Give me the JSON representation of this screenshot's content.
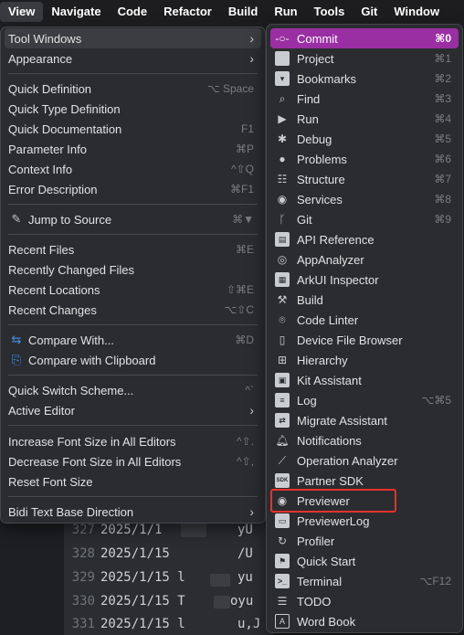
{
  "menubar": {
    "items": [
      "View",
      "Navigate",
      "Code",
      "Refactor",
      "Build",
      "Run",
      "Tools",
      "Git",
      "Window"
    ]
  },
  "editor": {
    "lines": [
      {
        "num": "327",
        "code": "2025/1/1"
      },
      {
        "num": "328",
        "code": "2025/1/15"
      },
      {
        "num": "329",
        "code": "2025/1/15 l"
      },
      {
        "num": "330",
        "code": "2025/1/15 T"
      },
      {
        "num": "331",
        "code": "2025/1/15 l"
      }
    ],
    "right_fragments": [
      "yU",
      "/U",
      "yu",
      "oyu",
      "u,J"
    ]
  },
  "view_menu": {
    "items": [
      {
        "label": "Tool Windows",
        "submenu": true,
        "highlighted": true
      },
      {
        "label": "Appearance",
        "submenu": true
      },
      {
        "label": "Quick Definition",
        "shortcut": "⌥ Space"
      },
      {
        "label": "Quick Type Definition",
        "shortcut": ""
      },
      {
        "label": "Quick Documentation",
        "shortcut": "F1"
      },
      {
        "label": "Parameter Info",
        "shortcut": "⌘P"
      },
      {
        "label": "Context Info",
        "shortcut": "^⇧Q"
      },
      {
        "label": "Error Description",
        "shortcut": "⌘F1"
      },
      {
        "label": "Jump to Source",
        "shortcut": "⌘▼",
        "icon": "pencil-icon"
      },
      {
        "label": "Recent Files",
        "shortcut": "⌘E"
      },
      {
        "label": "Recently Changed Files",
        "shortcut": ""
      },
      {
        "label": "Recent Locations",
        "shortcut": "⇧⌘E"
      },
      {
        "label": "Recent Changes",
        "shortcut": "⌥⇧C"
      },
      {
        "label": "Compare With...",
        "shortcut": "⌘D",
        "icon": "compare-icon"
      },
      {
        "label": "Compare with Clipboard",
        "shortcut": "",
        "icon": "clipboard-compare-icon"
      },
      {
        "label": "Quick Switch Scheme...",
        "shortcut": "^`"
      },
      {
        "label": "Active Editor",
        "submenu": true
      },
      {
        "label": "Increase Font Size in All Editors",
        "shortcut": "^⇧."
      },
      {
        "label": "Decrease Font Size in All Editors",
        "shortcut": "^⇧,"
      },
      {
        "label": "Reset Font Size",
        "shortcut": ""
      },
      {
        "label": "Bidi Text Base Direction",
        "submenu": true
      }
    ]
  },
  "tool_windows_menu": {
    "items": [
      {
        "label": "Commit",
        "shortcut": "⌘0",
        "icon": "commit-icon",
        "selected": true
      },
      {
        "label": "Project",
        "shortcut": "⌘1",
        "icon": "folder-icon"
      },
      {
        "label": "Bookmarks",
        "shortcut": "⌘2",
        "icon": "bookmark-icon"
      },
      {
        "label": "Find",
        "shortcut": "⌘3",
        "icon": "search-icon"
      },
      {
        "label": "Run",
        "shortcut": "⌘4",
        "icon": "run-icon"
      },
      {
        "label": "Debug",
        "shortcut": "⌘5",
        "icon": "bug-icon"
      },
      {
        "label": "Problems",
        "shortcut": "⌘6",
        "icon": "problems-icon"
      },
      {
        "label": "Structure",
        "shortcut": "⌘7",
        "icon": "structure-icon"
      },
      {
        "label": "Services",
        "shortcut": "⌘8",
        "icon": "services-icon"
      },
      {
        "label": "Git",
        "shortcut": "⌘9",
        "icon": "git-branch-icon"
      },
      {
        "label": "API Reference",
        "shortcut": "",
        "icon": "api-reference-icon"
      },
      {
        "label": "AppAnalyzer",
        "shortcut": "",
        "icon": "app-analyzer-icon"
      },
      {
        "label": "ArkUI Inspector",
        "shortcut": "",
        "icon": "inspector-icon"
      },
      {
        "label": "Build",
        "shortcut": "",
        "icon": "hammer-icon"
      },
      {
        "label": "Code Linter",
        "shortcut": "",
        "icon": "code-linter-icon"
      },
      {
        "label": "Device File Browser",
        "shortcut": "",
        "icon": "device-icon"
      },
      {
        "label": "Hierarchy",
        "shortcut": "",
        "icon": "hierarchy-icon"
      },
      {
        "label": "Kit Assistant",
        "shortcut": "",
        "icon": "kit-icon"
      },
      {
        "label": "Log",
        "shortcut": "⌥⌘5",
        "icon": "log-icon"
      },
      {
        "label": "Migrate Assistant",
        "shortcut": "",
        "icon": "migrate-icon"
      },
      {
        "label": "Notifications",
        "shortcut": "",
        "icon": "bell-icon"
      },
      {
        "label": "Operation Analyzer",
        "shortcut": "",
        "icon": "chart-icon"
      },
      {
        "label": "Partner SDK",
        "shortcut": "",
        "icon": "sdk-icon"
      },
      {
        "label": "Previewer",
        "shortcut": "",
        "icon": "eye-icon"
      },
      {
        "label": "PreviewerLog",
        "shortcut": "",
        "icon": "previewer-log-icon"
      },
      {
        "label": "Profiler",
        "shortcut": "",
        "icon": "profiler-icon"
      },
      {
        "label": "Quick Start",
        "shortcut": "",
        "icon": "quick-start-icon"
      },
      {
        "label": "Terminal",
        "shortcut": "⌥F12",
        "icon": "terminal-icon"
      },
      {
        "label": "TODO",
        "shortcut": "",
        "icon": "todo-icon"
      },
      {
        "label": "Word Book",
        "shortcut": "",
        "icon": "word-book-icon"
      }
    ]
  },
  "colors": {
    "selected_bg": "#9a2fa3",
    "highlight_bg": "#3b3d42",
    "annotation_box": "#e5322d"
  }
}
